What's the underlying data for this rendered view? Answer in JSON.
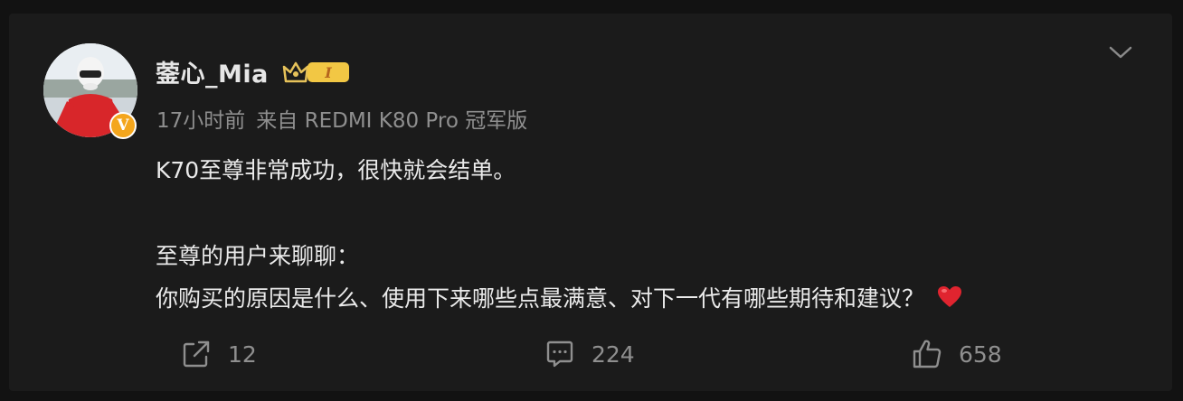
{
  "post": {
    "username": "蓥心_Mia",
    "level_badge": "I",
    "time": "17小时前",
    "source": "来自 REDMI K80 Pro 冠军版",
    "verified_mark": "V",
    "text_line1": "K70至尊非常成功，很快就会结单。",
    "text_line2": "至尊的用户来聊聊：",
    "text_line3": "你购买的原因是什么、使用下来哪些点最满意、对下一代有哪些期待和建议？"
  },
  "actions": {
    "repost_count": "12",
    "comment_count": "224",
    "like_count": "658"
  },
  "colors": {
    "background": "#121212",
    "card": "#1b1b1b",
    "text_primary": "#eaeaea",
    "text_secondary": "#8f8f8f",
    "verified_badge": "#f4a61d",
    "heart": "#e0242f"
  }
}
